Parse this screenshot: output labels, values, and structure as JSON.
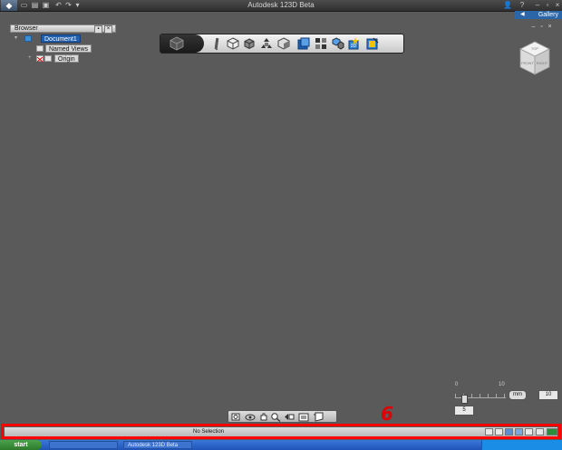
{
  "window": {
    "title": "Autodesk 123D Beta"
  },
  "quick_access": {
    "icons": [
      "app-logo-icon",
      "new-icon",
      "open-icon",
      "save-icon",
      "undo-icon",
      "redo-icon",
      "dropdown-icon"
    ]
  },
  "gallery": {
    "label": "Gallery"
  },
  "browser": {
    "title": "Browser",
    "nodes": [
      {
        "label": "Document1",
        "active": true
      },
      {
        "label": "Named Views",
        "active": false
      },
      {
        "label": "Origin",
        "active": false
      }
    ]
  },
  "toolbar": {
    "tools": [
      "sketch-icon",
      "box-primitive-icon",
      "extrude-icon",
      "move-icon",
      "construct-icon",
      "modify-icon",
      "pattern-icon",
      "group-icon",
      "text-3d-icon",
      "measure-icon",
      "materials-icon"
    ]
  },
  "snap": {
    "tick_min": "0",
    "tick_max": "10",
    "unit": "mm",
    "grid_value": "10",
    "snap_value": "5"
  },
  "annotation": {
    "number": "6"
  },
  "statusbar": {
    "text": "No Selection"
  },
  "taskbar": {
    "start": "start",
    "items": [
      "",
      "Autodesk 123D Beta"
    ]
  },
  "colors": {
    "highlight": "#ff0000",
    "selected_node": "#1f5fae",
    "canvas": "#5a5a5a"
  }
}
